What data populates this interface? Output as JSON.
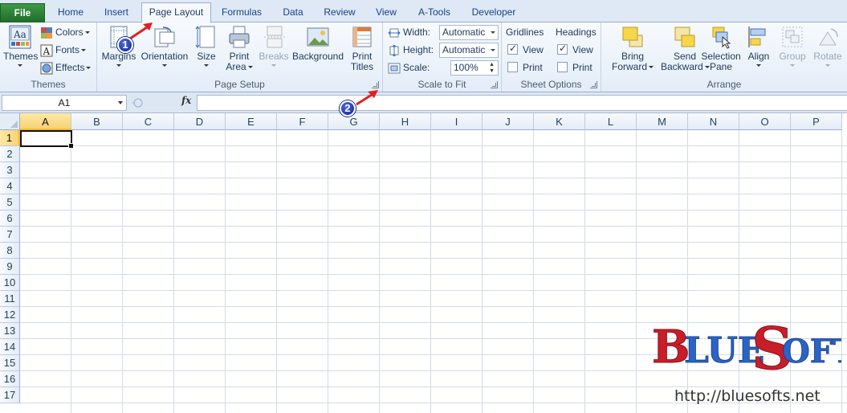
{
  "tabs": [
    {
      "label": "File"
    },
    {
      "label": "Home"
    },
    {
      "label": "Insert"
    },
    {
      "label": "Page Layout"
    },
    {
      "label": "Formulas"
    },
    {
      "label": "Data"
    },
    {
      "label": "Review"
    },
    {
      "label": "View"
    },
    {
      "label": "A-Tools"
    },
    {
      "label": "Developer"
    }
  ],
  "ribbon": {
    "themes": {
      "group_label": "Themes",
      "themes_label": "Themes",
      "colors_label": "Colors",
      "fonts_label": "Fonts",
      "effects_label": "Effects"
    },
    "page_setup": {
      "group_label": "Page Setup",
      "margins_label": "Margins",
      "orientation_label": "Orientation",
      "size_label": "Size",
      "print_area_line1": "Print",
      "print_area_line2": "Area",
      "breaks_label": "Breaks",
      "background_label": "Background",
      "print_titles_line1": "Print",
      "print_titles_line2": "Titles"
    },
    "scale_to_fit": {
      "group_label": "Scale to Fit",
      "width_label": "Width:",
      "width_value": "Automatic",
      "height_label": "Height:",
      "height_value": "Automatic",
      "scale_label": "Scale:",
      "scale_value": "100%"
    },
    "sheet_options": {
      "group_label": "Sheet Options",
      "gridlines_label": "Gridlines",
      "headings_label": "Headings",
      "view_label": "View",
      "print_label": "Print"
    },
    "arrange": {
      "group_label": "Arrange",
      "bring_forward_line1": "Bring",
      "bring_forward_line2": "Forward",
      "send_backward_line1": "Send",
      "send_backward_line2": "Backward",
      "selection_pane_line1": "Selection",
      "selection_pane_line2": "Pane",
      "align_label": "Align",
      "group_btn_label": "Group",
      "rotate_label": "Rotate"
    }
  },
  "formula_bar": {
    "name_box": "A1",
    "fx_label": "fx",
    "formula_value": ""
  },
  "grid": {
    "columns": [
      "A",
      "B",
      "C",
      "D",
      "E",
      "F",
      "G",
      "H",
      "I",
      "J",
      "K",
      "L",
      "M",
      "N",
      "O",
      "P"
    ],
    "rows": [
      "1",
      "2",
      "3",
      "4",
      "5",
      "6",
      "7",
      "8",
      "9",
      "10",
      "11",
      "12",
      "13",
      "14",
      "15",
      "16",
      "17"
    ],
    "active_cell": "A1"
  },
  "annotations": {
    "badge1": "1",
    "badge2": "2"
  },
  "watermark": {
    "logo_text": "BLUESOFTS",
    "url": "http://bluesofts.net"
  },
  "colors": {
    "file_tab": "#2c7a34",
    "selection_header": "#f8d275",
    "badge": "#0b1e8c",
    "arrow": "#e02020"
  }
}
